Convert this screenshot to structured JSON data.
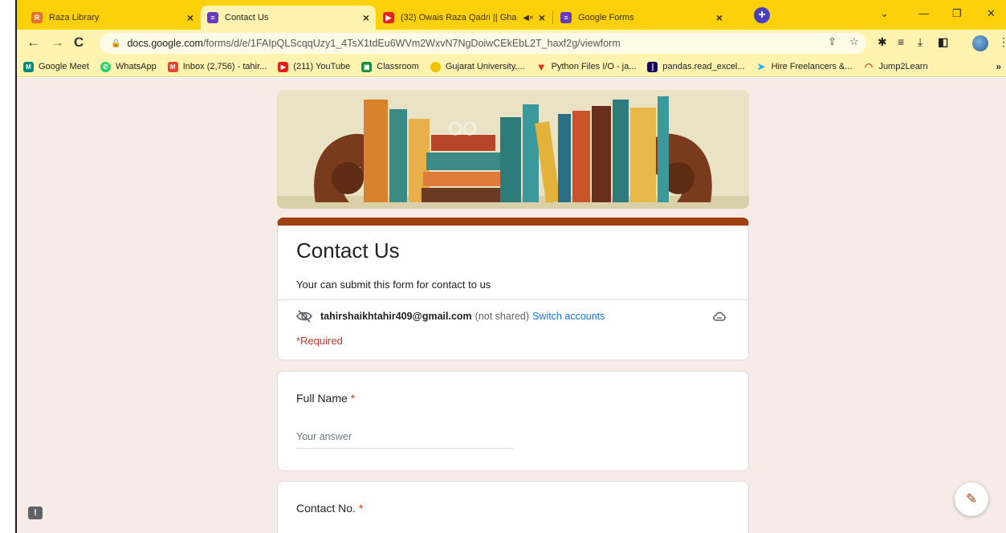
{
  "browser": {
    "tabs": [
      {
        "title": "Raza Library",
        "icon": "raza-library-favicon",
        "color": "#e8702a",
        "active": false
      },
      {
        "title": "Contact Us",
        "icon": "google-forms-favicon",
        "color": "#673ab7",
        "active": true
      },
      {
        "title": "(32) Owais Raza Qadri || Gha",
        "icon": "youtube-favicon",
        "color": "#e62117",
        "active": false,
        "muted": true
      },
      {
        "title": "Google Forms",
        "icon": "google-forms-favicon",
        "color": "#673ab7",
        "active": false
      }
    ],
    "url_host": "docs.google.com",
    "url_path": "/forms/d/e/1FAIpQLScqqUzy1_4TsX1tdEu6WVm2WxvN7NgDoiwCEkEbL2T_haxf2g/viewform",
    "bookmarks": [
      {
        "label": "Google Meet",
        "icon": "google-meet-icon",
        "color": "#00897b"
      },
      {
        "label": "WhatsApp",
        "icon": "whatsapp-icon",
        "color": "#25d366"
      },
      {
        "label": "Inbox (2,756) - tahir...",
        "icon": "gmail-icon",
        "color": "#ea4335"
      },
      {
        "label": "(211) YouTube",
        "icon": "youtube-icon",
        "color": "#e62117"
      },
      {
        "label": "Classroom",
        "icon": "classroom-icon",
        "color": "#1e8e3e"
      },
      {
        "label": "Gujarat University,...",
        "icon": "gujarat-university-icon",
        "color": "#f2c400"
      },
      {
        "label": "Python Files I/O - ja...",
        "icon": "python-files-icon",
        "color": "#d93025"
      },
      {
        "label": "pandas.read_excel...",
        "icon": "pandas-icon",
        "color": "#150458"
      },
      {
        "label": "Hire Freelancers &...",
        "icon": "freelancer-icon",
        "color": "#29b2fe"
      },
      {
        "label": "Jump2Learn",
        "icon": "jump2learn-icon",
        "color": "#e8452c"
      }
    ]
  },
  "form": {
    "title": "Contact Us",
    "description": "Your can submit this form for contact to us",
    "account_email": "tahirshaikhtahir409@gmail.com",
    "not_shared": "(not shared)",
    "switch_accounts": "Switch accounts",
    "required_note": "*Required",
    "questions": [
      {
        "label": "Full Name",
        "required_mark": "*",
        "placeholder": "Your answer"
      },
      {
        "label": "Contact No.",
        "required_mark": "*"
      }
    ]
  },
  "colors": {
    "theme": "#a04012",
    "page_bg": "#f6ebe6",
    "tabstrip": "#fdd10a",
    "link": "#1a73e8",
    "required": "#d93025"
  }
}
